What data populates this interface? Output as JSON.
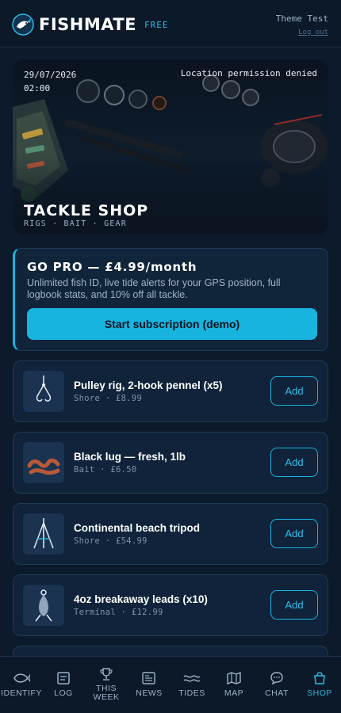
{
  "header": {
    "app_name": "FISHMATE",
    "plan_badge": "FREE",
    "user_name": "Theme Test",
    "logout_label": "Log out"
  },
  "hero": {
    "date": "29/07/2026",
    "time": "02:00",
    "location_status": "Location permission denied",
    "title": "TACKLE SHOP",
    "subtitle": "RIGS · BAIT · GEAR"
  },
  "pro": {
    "title": "GO PRO — £4.99/month",
    "description": "Unlimited fish ID, live tide alerts for your GPS position, full logbook stats, and 10% off all tackle.",
    "button_label": "Start subscription (demo)"
  },
  "products": [
    {
      "name": "Pulley rig, 2-hook pennel (x5)",
      "meta": "Shore · £8.99",
      "icon": "rig-icon",
      "add_label": "Add"
    },
    {
      "name": "Black lug — fresh, 1lb",
      "meta": "Bait · £6.50",
      "icon": "lugworm-icon",
      "add_label": "Add"
    },
    {
      "name": "Continental beach tripod",
      "meta": "Shore · £54.99",
      "icon": "tripod-icon",
      "add_label": "Add"
    },
    {
      "name": "4oz breakaway leads (x10)",
      "meta": "Terminal · £12.99",
      "icon": "lead-weight-icon",
      "add_label": "Add"
    }
  ],
  "nav": {
    "items": [
      {
        "label": "IDENTIFY",
        "icon": "fish-icon"
      },
      {
        "label": "LOG",
        "icon": "logbook-icon"
      },
      {
        "label_line1": "THIS",
        "label_line2": "WEEK",
        "icon": "trophy-icon"
      },
      {
        "label": "NEWS",
        "icon": "newspaper-icon"
      },
      {
        "label": "TIDES",
        "icon": "waves-icon"
      },
      {
        "label": "MAP",
        "icon": "map-icon"
      },
      {
        "label": "CHAT",
        "icon": "chat-icon"
      },
      {
        "label": "SHOP",
        "icon": "shopping-bag-icon"
      }
    ],
    "active": "SHOP"
  },
  "colors": {
    "background": "#0c1a2b",
    "accent": "#18b4e0",
    "card": "#10233a",
    "muted_text": "#9fb3c8"
  }
}
